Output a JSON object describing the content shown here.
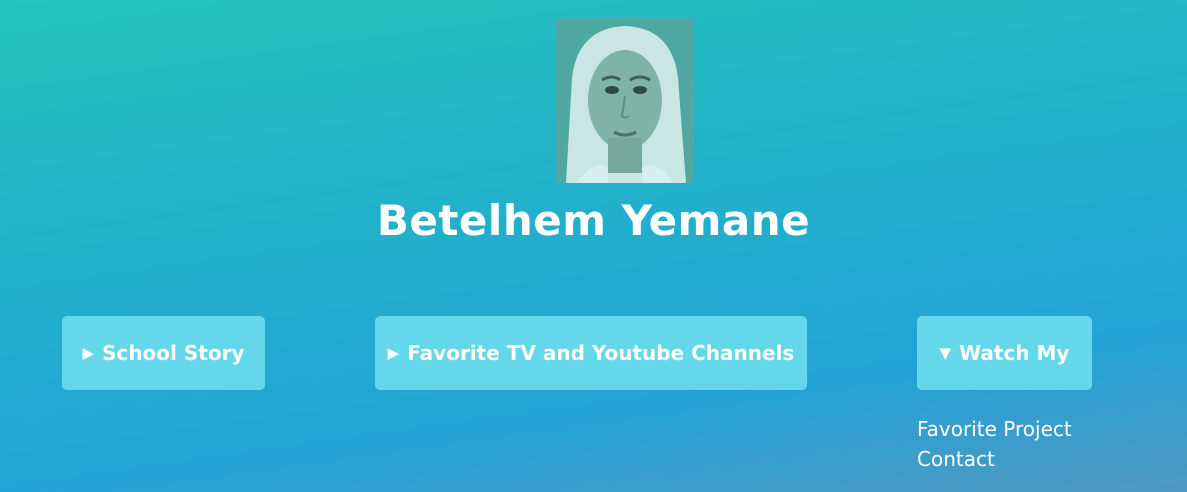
{
  "profile": {
    "name": "Betelhem Yemane",
    "photo_icon": "portrait-photo"
  },
  "nav": {
    "buttons": [
      {
        "label": "School Story",
        "caret": "▶",
        "expanded": false
      },
      {
        "label": "Favorite TV and Youtube Channels",
        "caret": "▶",
        "expanded": false
      },
      {
        "label": "Watch My",
        "caret": "▼",
        "expanded": true
      }
    ],
    "dropdown_items": [
      "Favorite Project",
      "Contact"
    ]
  },
  "colors": {
    "background_top": "#23c4bb",
    "background_bottom": "#22a3d6",
    "button": "#64d8ea",
    "text": "#ffffff"
  }
}
